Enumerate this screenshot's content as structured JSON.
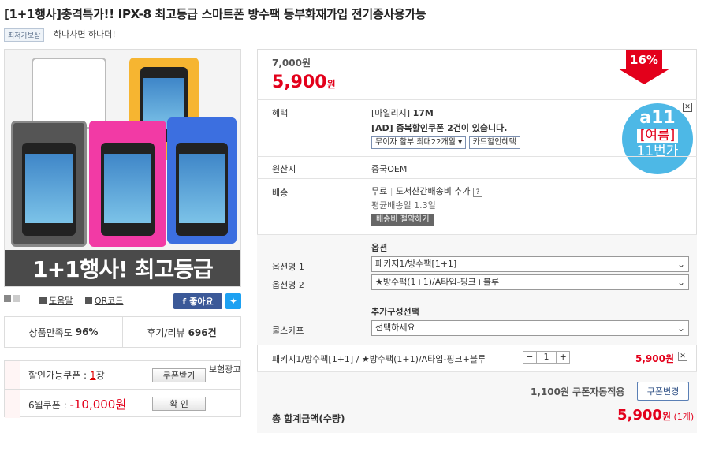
{
  "product": {
    "title": "[1+1행사]충격특가!! IPX-8 최고등급 스마트폰 방수팩 동부화재가입 전기종사용가능",
    "badge": "최저가보상",
    "subtitle": "하나사면 하나더!",
    "image_banner": "1+1행사! 최고등급"
  },
  "links": {
    "preview": "도움말",
    "qrcode": "QR코드",
    "facebook": "좋아요",
    "twitter_icon": "twitter-icon"
  },
  "rating": {
    "satisfaction_label": "상품만족도",
    "satisfaction_value": "96%",
    "review_label": "후기/리뷰",
    "review_value": "696건"
  },
  "coupons": {
    "available_label": "할인가능쿠폰 :",
    "available_count": "1",
    "available_unit": "장",
    "get_button": "쿠폰받기",
    "ad_label": "보험광고",
    "june_label": "6월쿠폰 :",
    "june_value": "-10,000원",
    "confirm_button": "확   인"
  },
  "price": {
    "original": "7,000원",
    "sale": "5,900",
    "sale_unit": "원",
    "discount": "16%"
  },
  "benefit": {
    "label": "혜택",
    "mileage_prefix": "[마일리지]",
    "mileage_value": "17M",
    "ad_text": "[AD] 중복할인쿠폰 2건이 있습니다.",
    "installment_button": "무이자 할부 최대22개월",
    "card_button": "카드할인혜택"
  },
  "promo": {
    "line1": "a11",
    "line2": "[여름]",
    "line3": "11번가"
  },
  "origin": {
    "label": "원산지",
    "value": "중국OEM"
  },
  "shipping": {
    "label": "배송",
    "free": "무료",
    "extra": "도서산간배송비 추가",
    "avg": "평균배송일 1.3일",
    "calc_button": "배송비 절약하기"
  },
  "options": {
    "header": "옵션",
    "name1_label": "옵션명 1",
    "name1_value": "패키지1/방수팩[1+1]",
    "name2_label": "옵션명 2",
    "name2_value": "★방수팩(1+1)/A타입-핑크+블루",
    "addl_header": "추가구성선택",
    "addl_label": "쿨스카프",
    "addl_value": "선택하세요"
  },
  "selection": {
    "text": "패키지1/방수팩[1+1] / ★방수팩(1+1)/A타입-핑크+블루",
    "qty": "1",
    "minus": "−",
    "plus": "+",
    "price": "5,900원"
  },
  "coupon_apply": {
    "text": "1,100원 쿠폰자동적용",
    "change_button": "쿠폰변경"
  },
  "total": {
    "label": "총 합계금액(수량)",
    "value": "5,900",
    "unit": "원",
    "count": "(1개)"
  }
}
